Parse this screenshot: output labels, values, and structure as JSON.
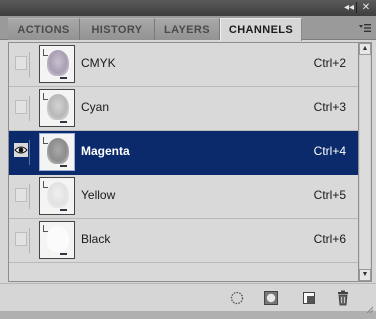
{
  "window": {
    "collapse_glyph": "◂◂",
    "close_glyph": "✕"
  },
  "tabs": [
    {
      "label": "ACTIONS",
      "active": false
    },
    {
      "label": "HISTORY",
      "active": false
    },
    {
      "label": "LAYERS",
      "active": false
    },
    {
      "label": "CHANNELS",
      "active": true
    }
  ],
  "panel_menu_icon": "panel-menu-icon",
  "channels": [
    {
      "name": "CMYK",
      "shortcut": "Ctrl+2",
      "visible": false,
      "selected": false
    },
    {
      "name": "Cyan",
      "shortcut": "Ctrl+3",
      "visible": false,
      "selected": false
    },
    {
      "name": "Magenta",
      "shortcut": "Ctrl+4",
      "visible": true,
      "selected": true
    },
    {
      "name": "Yellow",
      "shortcut": "Ctrl+5",
      "visible": false,
      "selected": false
    },
    {
      "name": "Black",
      "shortcut": "Ctrl+6",
      "visible": false,
      "selected": false
    }
  ],
  "toolbar": {
    "buttons": [
      "load-channel-as-selection-icon",
      "save-selection-as-channel-icon",
      "new-channel-icon",
      "delete-channel-icon"
    ]
  },
  "colors": {
    "selection": "#0b2a6b",
    "panel": "#d6d6d6",
    "title": "#4a4a4a"
  }
}
